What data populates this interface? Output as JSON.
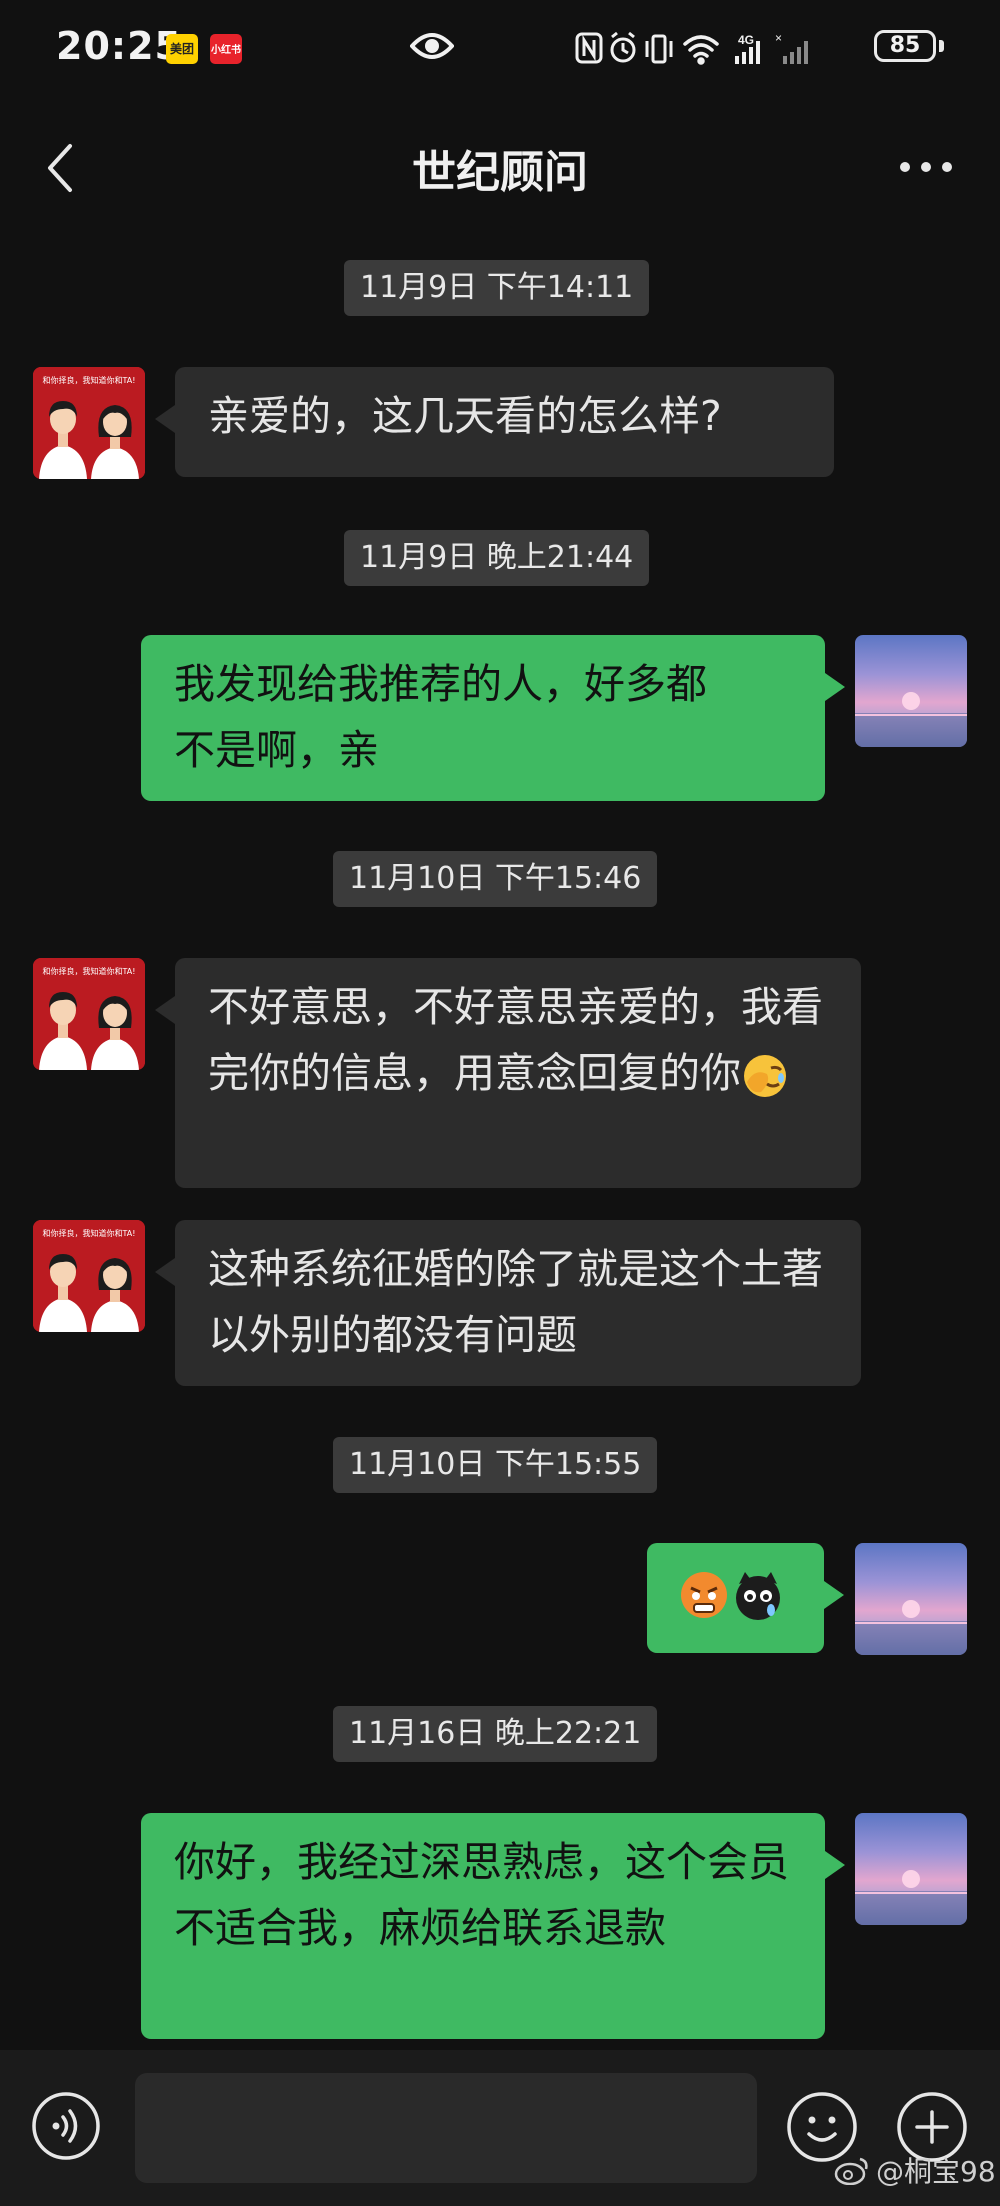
{
  "status_bar": {
    "time": "20:25",
    "app_badge_1": "美团",
    "app_badge_2": "小红书",
    "battery": "85"
  },
  "header": {
    "title": "世纪顾问"
  },
  "avatar_counselor_text": "和你择良，我知道你和TA!",
  "messages": [
    {
      "type": "time",
      "text": "11月9日 下午14:11"
    },
    {
      "type": "incoming",
      "text": "亲爱的，这几天看的怎么样?"
    },
    {
      "type": "time",
      "text": "11月9日 晚上21:44"
    },
    {
      "type": "outgoing",
      "line1": "我发现给我推荐的人，好多都",
      "line2_start": "不是",
      "line2_end": "啊，亲"
    },
    {
      "type": "time",
      "text": "11月10日 下午15:46"
    },
    {
      "type": "incoming",
      "text": "不好意思，不好意思亲爱的，我看完你的信息，用意念回复的你"
    },
    {
      "type": "incoming",
      "text": "这种系统征婚的除了就是这个土著以外别的都没有问题"
    },
    {
      "type": "time",
      "text": "11月10日 下午15:55"
    },
    {
      "type": "outgoing",
      "emojis": [
        "angry-face",
        "black-cat-cry"
      ]
    },
    {
      "type": "time",
      "text": "11月16日 晚上22:21"
    },
    {
      "type": "outgoing",
      "text": "你好，我经过深思熟虑，这个会员不适合我，麻烦给联系退款"
    }
  ],
  "watermark": "@桐宝98",
  "colors": {
    "incoming_bubble": "#2c2c2c",
    "outgoing_bubble": "#3fba62",
    "time_stamp": "#3b3b3b",
    "background": "#111111"
  }
}
